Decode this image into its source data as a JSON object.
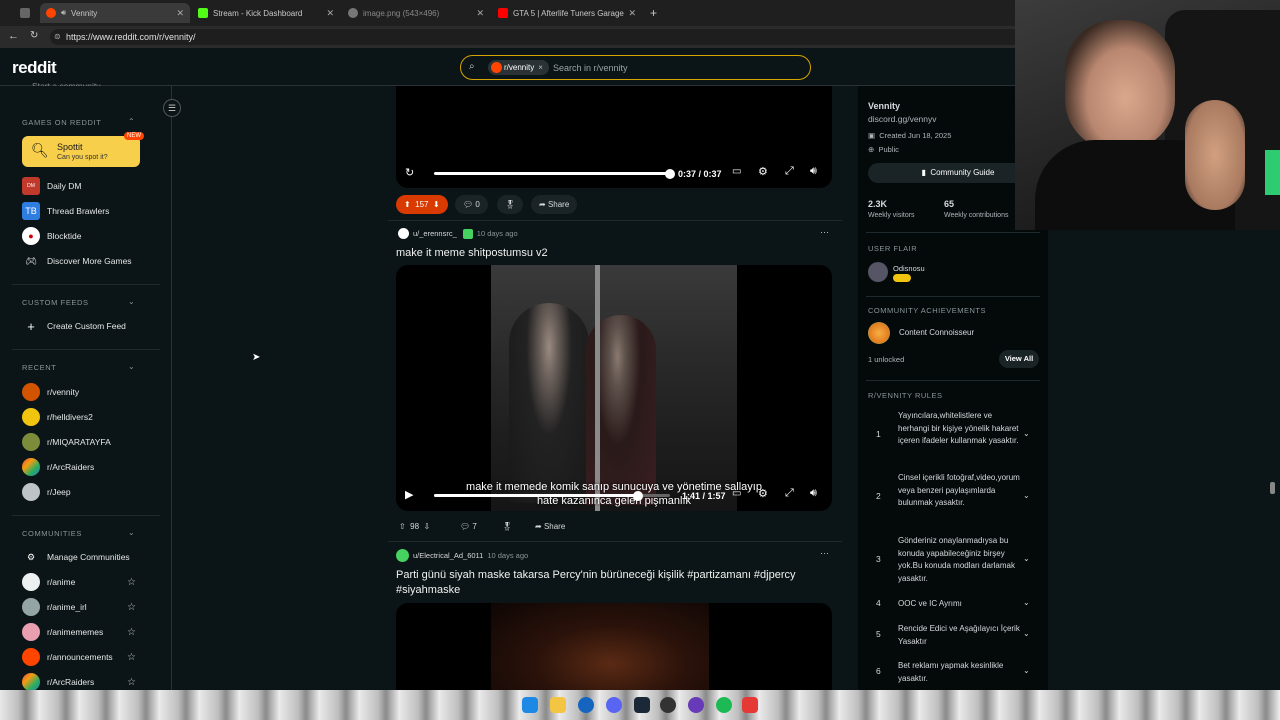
{
  "browser": {
    "tabs": [
      {
        "label": "Vennity",
        "color": "#ff4500",
        "active": true
      },
      {
        "label": "Stream - Kick Dashboard",
        "color": "#53fc18"
      },
      {
        "label": "image.png (543×496)",
        "color": "#777777"
      },
      {
        "label": "GTA 5 | Afterlife Tuners Garage V2",
        "color": "#ff0000"
      }
    ],
    "new_tab": "+",
    "url": "https://www.reddit.com/r/vennity/"
  },
  "header": {
    "logo": "reddit",
    "search_chip": "r/vennity",
    "search_chip_close": "×",
    "search_placeholder": "Search in r/vennity"
  },
  "sidebar": {
    "top_item": "Start a community",
    "games_header": "GAMES ON REDDIT",
    "spottit": {
      "title": "Spottit",
      "subtitle": "Can you spot it?",
      "badge": "NEW"
    },
    "games": [
      "Daily DM",
      "Thread Brawlers",
      "Blocktide",
      "Discover More Games"
    ],
    "custom_feeds_header": "CUSTOM FEEDS",
    "create_feed": "Create Custom Feed",
    "recent_header": "RECENT",
    "recent": [
      "r/vennity",
      "r/helldivers2",
      "r/MIQARATAYFA",
      "r/ArcRaiders",
      "r/Jeep"
    ],
    "communities_header": "COMMUNITIES",
    "manage": "Manage Communities",
    "communities": [
      "r/anime",
      "r/anime_irl",
      "r/animememes",
      "r/announcements",
      "r/ArcRaiders"
    ]
  },
  "feed": {
    "post1": {
      "time": "0:37 / 0:37",
      "progress": 1.0,
      "votes": "157",
      "comments": "0",
      "share": "Share"
    },
    "post2": {
      "author": "u/_erennsrc_",
      "ago": "10 days ago",
      "more": "···",
      "title": "make it meme shitpostumsu v2",
      "caption": "make it memede komik sanıp sunucuya ve yönetime sallayıp hate kazanınca gelen pişmanlık",
      "time": "1:41 / 1:57",
      "progress": 0.863,
      "votes": "98",
      "comments": "7",
      "share": "Share"
    },
    "post3": {
      "author": "u/Electrical_Ad_6011",
      "ago": "10 days ago",
      "more": "···",
      "title": "Parti günü siyah maske takarsa Percy'nin bürüneceği kişilik #partizamanı #djpercy #siyahmaske"
    }
  },
  "about": {
    "name": "Vennity",
    "link": "discord.gg/vennyv",
    "created": "Created Jun 18, 2025",
    "visibility": "Public",
    "guide_button": "Community Guide",
    "visitors": "2.3K",
    "visitors_label": "Weekly visitors",
    "contributions": "65",
    "contributions_label": "Weekly contributions",
    "flair_header": "USER FLAIR",
    "flair_user": "Odisnosu",
    "achievements_header": "COMMUNITY ACHIEVEMENTS",
    "achievement": "Content Connoisseur",
    "unlocked": "1 unlocked",
    "view_all": "View All",
    "rules_header": "R/VENNITY RULES",
    "rules": [
      {
        "n": "1",
        "text": "Yayıncılara,whitelistlere ve herhangi bir kişiye yönelik hakaret içeren ifadeler kullanmak yasaktır."
      },
      {
        "n": "2",
        "text": "Cinsel içerikli fotoğraf,video,yorum veya benzeri paylaşımlarda bulunmak yasaktır."
      },
      {
        "n": "3",
        "text": "Gönderiniz onaylanmadıysa bu konuda yapabileceğiniz birşey yok.Bu konuda modları darlamak yasaktır."
      },
      {
        "n": "4",
        "text": "OOC ve IC Ayrımı"
      },
      {
        "n": "5",
        "text": "Rencide Edici ve Aşağılayıcı İçerik Yasaktır"
      },
      {
        "n": "6",
        "text": "Bet reklamı yapmak kesinlikle yasaktır."
      }
    ]
  },
  "colors": {
    "accent": "#ff4500",
    "bg": "#0b1416",
    "search_border": "#d7a400",
    "spottit": "#f8cf4a"
  }
}
